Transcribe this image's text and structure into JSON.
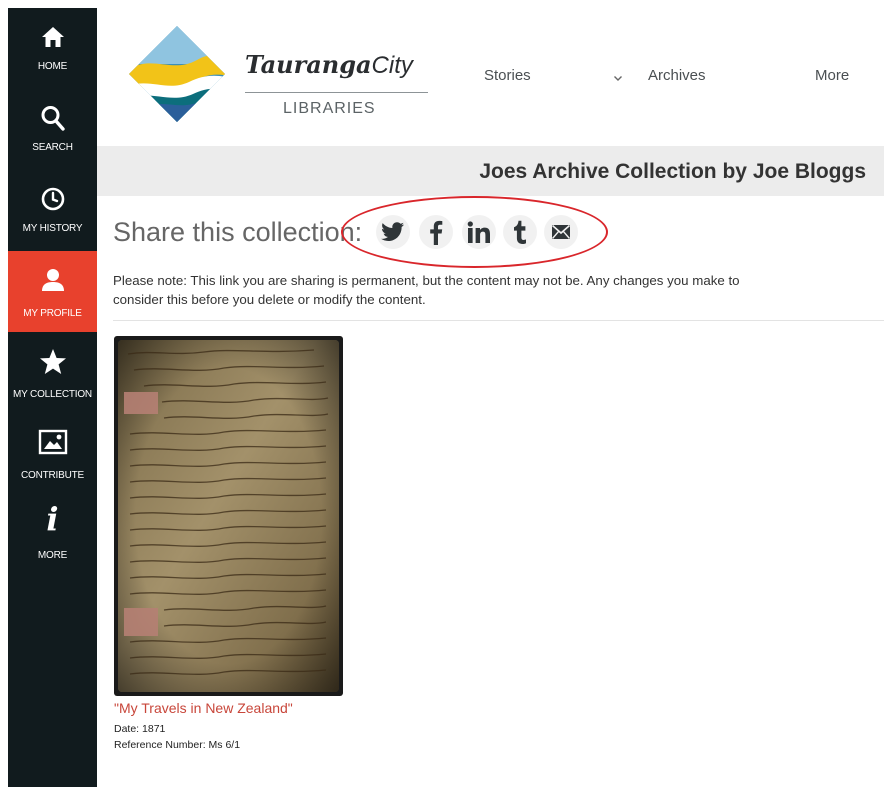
{
  "sidebar": {
    "items": [
      {
        "label": "HOME",
        "icon": "home-icon"
      },
      {
        "label": "SEARCH",
        "icon": "search-icon"
      },
      {
        "label": "MY HISTORY",
        "icon": "clock-icon"
      },
      {
        "label": "MY PROFILE",
        "icon": "person-icon",
        "active": true
      },
      {
        "label": "MY COLLECTION",
        "icon": "star-icon"
      },
      {
        "label": "CONTRIBUTE",
        "icon": "image-icon"
      },
      {
        "label": "MORE",
        "icon": "info-icon"
      }
    ],
    "bg_color": "#111b1e",
    "active_color": "#e8412d"
  },
  "header": {
    "brand": {
      "name": "Tauranga",
      "city": "City",
      "sub": "LIBRARIES"
    },
    "nav": [
      {
        "label": "Stories"
      },
      {
        "label": "Archives",
        "chevron": "chevron-down-icon"
      },
      {
        "label": "More"
      }
    ]
  },
  "collection": {
    "title": "Joes Archive Collection by Joe Bloggs",
    "share_heading": "Share this collection:",
    "share_icons": [
      "twitter-icon",
      "facebook-icon",
      "linkedin-icon",
      "tumblr-icon",
      "email-icon"
    ],
    "note_line1": "Please note: This link you are sharing is permanent, but the content may not be. Any changes you make to",
    "note_line2": "consider this before you delete or modify the content.",
    "items": [
      {
        "title": "\"My Travels in New Zealand\"",
        "date": "Date: 1871",
        "reference": "Reference Number: Ms 6/1",
        "thumbnail": "handwritten-diary-page"
      }
    ],
    "highlight_color": "#d9262b",
    "link_color": "#c8463a"
  }
}
